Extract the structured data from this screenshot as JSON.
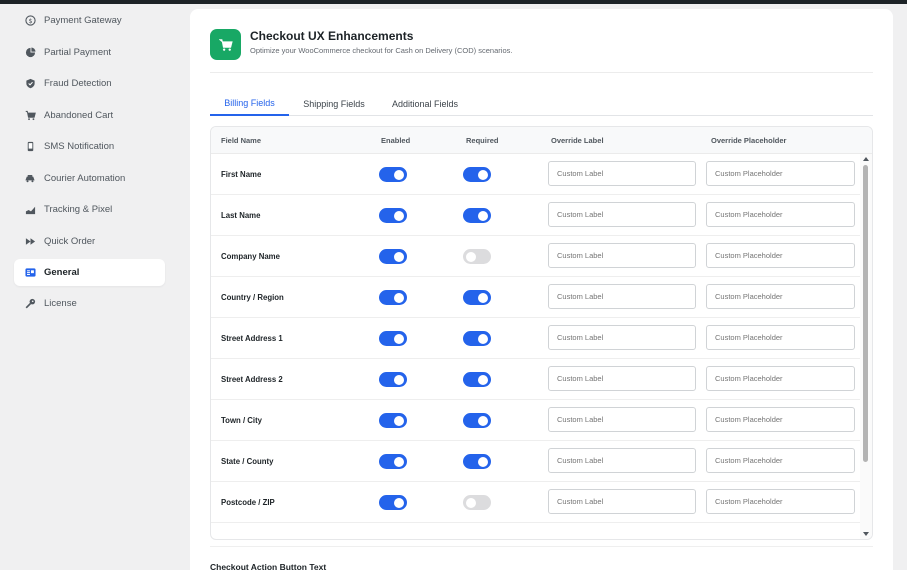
{
  "sidebar": {
    "items": [
      {
        "label": "Payment Gateway",
        "icon": "dollar-circle-icon"
      },
      {
        "label": "Partial Payment",
        "icon": "pie-chart-icon"
      },
      {
        "label": "Fraud Detection",
        "icon": "shield-icon"
      },
      {
        "label": "Abandoned Cart",
        "icon": "cart-icon"
      },
      {
        "label": "SMS Notification",
        "icon": "phone-icon"
      },
      {
        "label": "Courier Automation",
        "icon": "truck-icon"
      },
      {
        "label": "Tracking & Pixel",
        "icon": "chart-icon"
      },
      {
        "label": "Quick Order",
        "icon": "fast-forward-icon"
      },
      {
        "label": "General",
        "icon": "settings-icon",
        "active": true
      },
      {
        "label": "License",
        "icon": "key-icon"
      }
    ]
  },
  "header": {
    "title": "Checkout UX Enhancements",
    "subtitle": "Optimize your WooCommerce checkout for Cash on Delivery (COD) scenarios.",
    "icon": "cart-icon"
  },
  "tabs": [
    {
      "label": "Billing Fields",
      "active": true
    },
    {
      "label": "Shipping Fields",
      "active": false
    },
    {
      "label": "Additional Fields",
      "active": false
    }
  ],
  "table": {
    "columns": [
      "Field Name",
      "Enabled",
      "Required",
      "Override Label",
      "Override Placeholder"
    ],
    "label_placeholder": "Custom Label",
    "placeholder_placeholder": "Custom Placeholder",
    "rows": [
      {
        "name": "First Name",
        "enabled": true,
        "required": true
      },
      {
        "name": "Last Name",
        "enabled": true,
        "required": true
      },
      {
        "name": "Company Name",
        "enabled": true,
        "required": false
      },
      {
        "name": "Country / Region",
        "enabled": true,
        "required": true
      },
      {
        "name": "Street Address 1",
        "enabled": true,
        "required": true
      },
      {
        "name": "Street Address 2",
        "enabled": true,
        "required": true
      },
      {
        "name": "Town / City",
        "enabled": true,
        "required": true
      },
      {
        "name": "State / County",
        "enabled": true,
        "required": true
      },
      {
        "name": "Postcode / ZIP",
        "enabled": true,
        "required": false
      }
    ]
  },
  "action_section": {
    "label": "Checkout Action Button Text"
  },
  "colors": {
    "accent": "#2463eb",
    "brand": "#18a865",
    "toggle_off": "#dcdcde"
  }
}
